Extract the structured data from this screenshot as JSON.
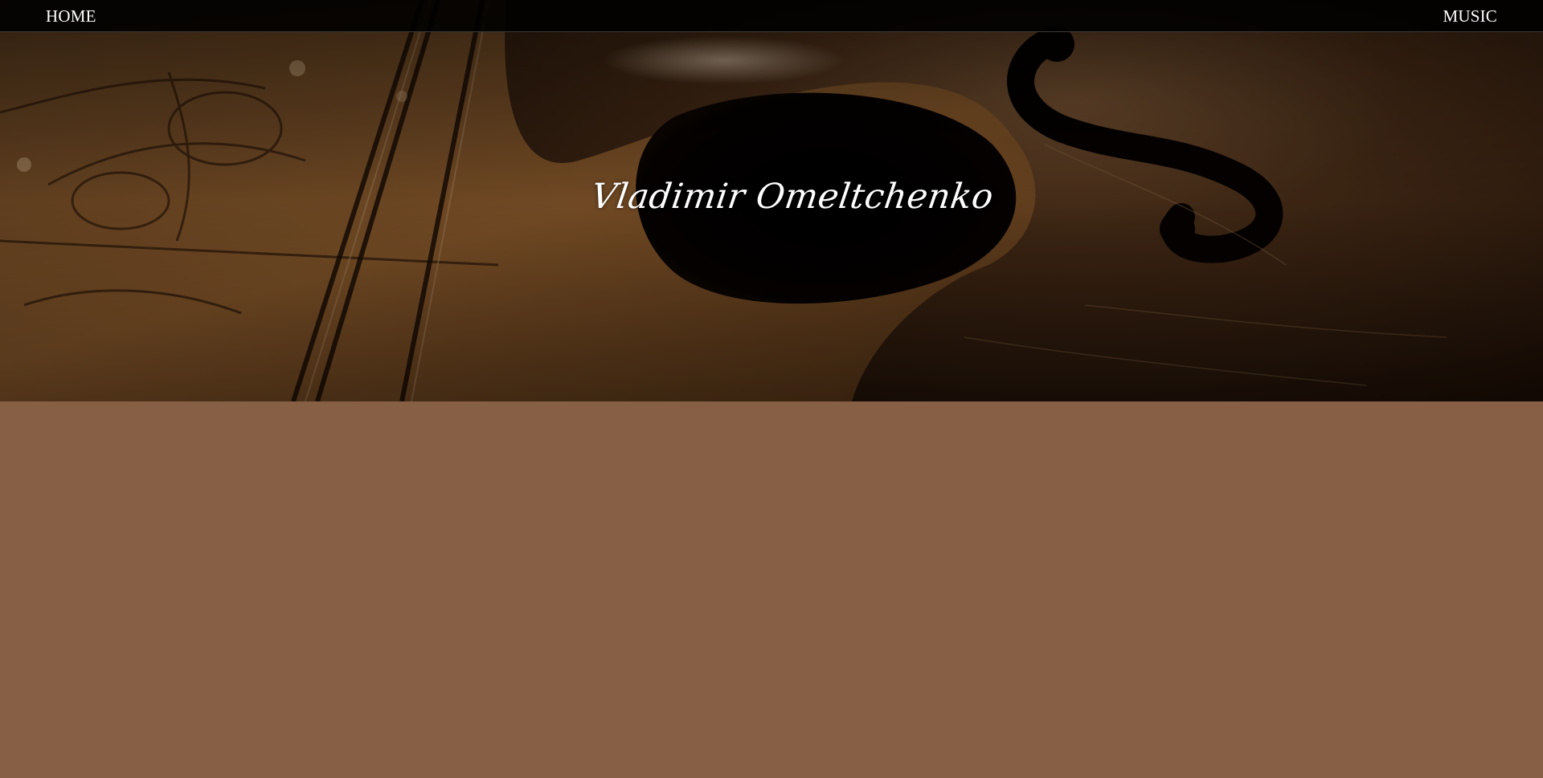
{
  "nav": {
    "home_label": "HOME",
    "music_label": "MUSIC"
  },
  "hero": {
    "title": "Vladimir Omeltchenko",
    "image": "violin-image"
  },
  "colors": {
    "page_background": "#875f45",
    "navbar_background": "#000000",
    "text": "#ffffff"
  }
}
